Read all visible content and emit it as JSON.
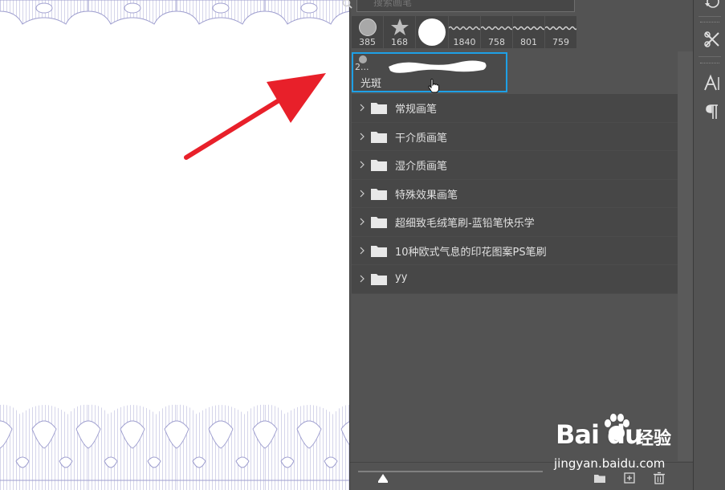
{
  "search": {
    "placeholder": "搜索画笔"
  },
  "presets": [
    {
      "size": "385",
      "shape": "circle-hard"
    },
    {
      "size": "168",
      "shape": "star"
    },
    {
      "size": "",
      "shape": "circle-soft"
    },
    {
      "size": "1840",
      "shape": "pattern-line"
    },
    {
      "size": "758",
      "shape": "pattern-line"
    },
    {
      "size": "801",
      "shape": "pattern-line"
    },
    {
      "size": "759",
      "shape": "pattern-line"
    }
  ],
  "selected_brush": {
    "size": "2...",
    "name": "光斑"
  },
  "groups": [
    {
      "label": "常规画笔"
    },
    {
      "label": "干介质画笔"
    },
    {
      "label": "湿介质画笔"
    },
    {
      "label": "特殊效果画笔"
    },
    {
      "label": "超细致毛绒笔刷-蓝铅笔快乐学"
    },
    {
      "label": "10种欧式气息的印花图案PS笔刷"
    },
    {
      "label": "yy"
    }
  ],
  "watermark": {
    "brand": "Bai  du",
    "cn": "经验",
    "url": "jingyan.baidu.com"
  },
  "colors": {
    "panel": "#535353",
    "row": "#474747",
    "selection": "#1ea0e6",
    "arrow": "#e8202a",
    "border_pattern": "#c9c9e6"
  }
}
